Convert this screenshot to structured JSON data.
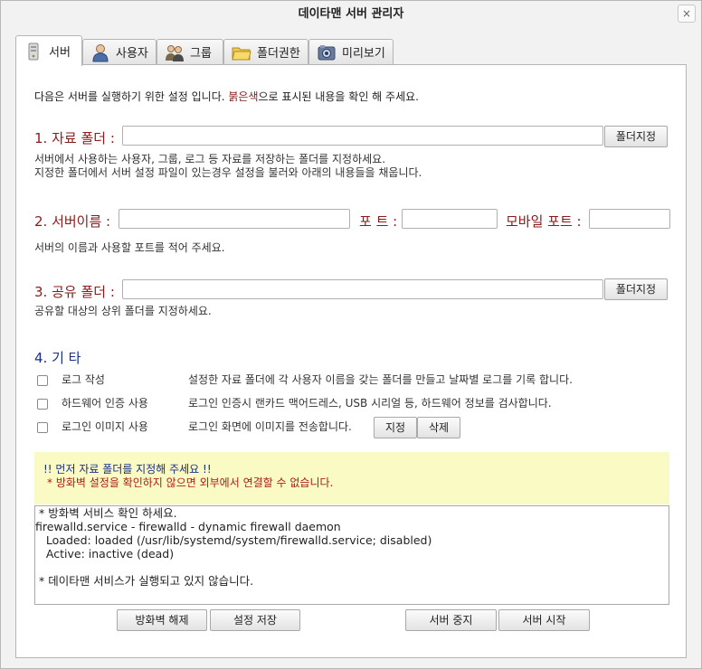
{
  "window": {
    "title": "데이타맨 서버 관리자",
    "close_label": "×"
  },
  "tabs": [
    {
      "label": "서버",
      "icon": "server-icon"
    },
    {
      "label": "사용자",
      "icon": "user-icon"
    },
    {
      "label": "그룹",
      "icon": "group-icon"
    },
    {
      "label": "폴더권한",
      "icon": "folder-icon"
    },
    {
      "label": "미리보기",
      "icon": "preview-icon"
    }
  ],
  "intro": {
    "before": "다음은 서버를 실행하기 위한 설정 입니다. ",
    "highlight": "붉은색",
    "after": "으로 표시된 내용을 확인 해 주세요."
  },
  "section1": {
    "label": "1. 자료 폴더 :",
    "value": "",
    "button": "폴더지정",
    "desc1": "서버에서 사용하는 사용자, 그룹, 로그 등 자료를 저장하는 폴더를 지정하세요.",
    "desc2": "지정한 폴더에서 서버 설정 파일이 있는경우 설정을 불러와 아래의 내용들을 채웁니다."
  },
  "section2": {
    "label": "2. 서버이름 :",
    "port_label": "포 트 :",
    "mobile_port_label": "모바일 포트 :",
    "server_name": "",
    "port": "",
    "mobile_port": "",
    "desc": "서버의 이름과 사용할 포트를 적어 주세요."
  },
  "section3": {
    "label": "3. 공유 폴더 :",
    "value": "",
    "button": "폴더지정",
    "desc": "공유할 대상의 상위 폴더를 지정하세요."
  },
  "section4": {
    "label": "4. 기 타",
    "options": [
      {
        "label": "로그 작성",
        "desc": "설정한 자료 폴더에 각 사용자 이름을 갖는 폴더를 만들고 날짜별 로그를 기록 합니다.",
        "checked": false
      },
      {
        "label": "하드웨어 인증 사용",
        "desc": "로그인 인증시 랜카드 맥어드레스, USB 시리얼 등, 하드웨어 정보를 검사합니다.",
        "checked": false
      },
      {
        "label": "로그인 이미지 사용",
        "desc": "로그인 화면에 이미지를 전송합니다.",
        "checked": false
      }
    ],
    "set_button": "지정",
    "delete_button": "삭제"
  },
  "warning": {
    "line1": "!! 먼저 자료 폴더를 지정해 주세요 !!",
    "line2": "* 방화벽 설정을 확인하지 않으면 외부에서 연결할 수 없습니다."
  },
  "log_lines": [
    " * 방화벽 서비스 확인 하세요.",
    "firewalld.service - firewalld - dynamic firewall daemon",
    "   Loaded: loaded (/usr/lib/systemd/system/firewalld.service; disabled)",
    "   Active: inactive (dead)",
    "",
    " * 데이타맨 서비스가 실행되고 있지 않습니다."
  ],
  "buttons": {
    "firewall_off": "방화벽 해제",
    "save_settings": "설정 저장",
    "stop_server": "서버 중지",
    "start_server": "서버 시작"
  }
}
